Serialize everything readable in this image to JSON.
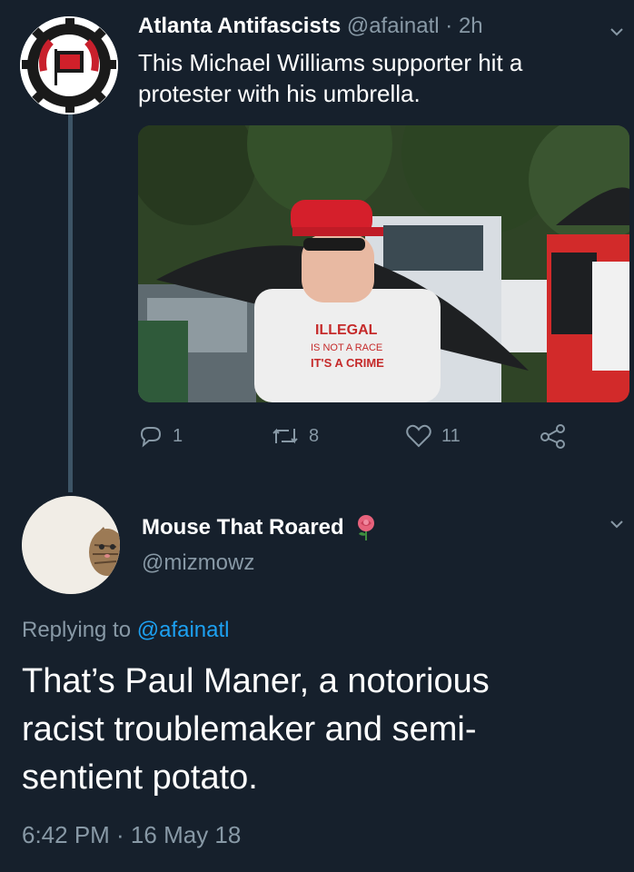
{
  "tweet": {
    "author_name": "Atlanta Antifascists",
    "author_handle": "@afainatl",
    "time_ago": "2h",
    "text_lines": [
      "This Michael Williams supporter hit a",
      "protester with his umbrella."
    ],
    "photo_shirt_text": [
      "ILLEGAL",
      "IS NOT A RACE",
      "IT'S A CRIME"
    ],
    "actions": {
      "reply_count": "1",
      "retweet_count": "8",
      "like_count": "11"
    }
  },
  "reply": {
    "author_name": "Mouse That Roared",
    "author_handle": "@mizmowz",
    "replying_label": "Replying to",
    "replying_to": "@afainatl",
    "text_lines": [
      "That’s Paul Maner, a notorious",
      "racist troublemaker and semi-",
      "sentient potato."
    ],
    "timestamp": "6:42 PM · 16 May 18"
  },
  "icons": {
    "avatar1": "antifa-logo-icon",
    "reply": "reply-icon",
    "retweet": "retweet-icon",
    "like": "heart-icon",
    "share": "share-icon",
    "menu": "chevron-down-icon",
    "rose": "rose-emoji-icon",
    "avatar2": "cat-avatar-icon"
  },
  "colors": {
    "background": "#16202c",
    "secondary_text": "#8899a6",
    "link": "#1da1f2",
    "thread_line": "#3d5466"
  }
}
